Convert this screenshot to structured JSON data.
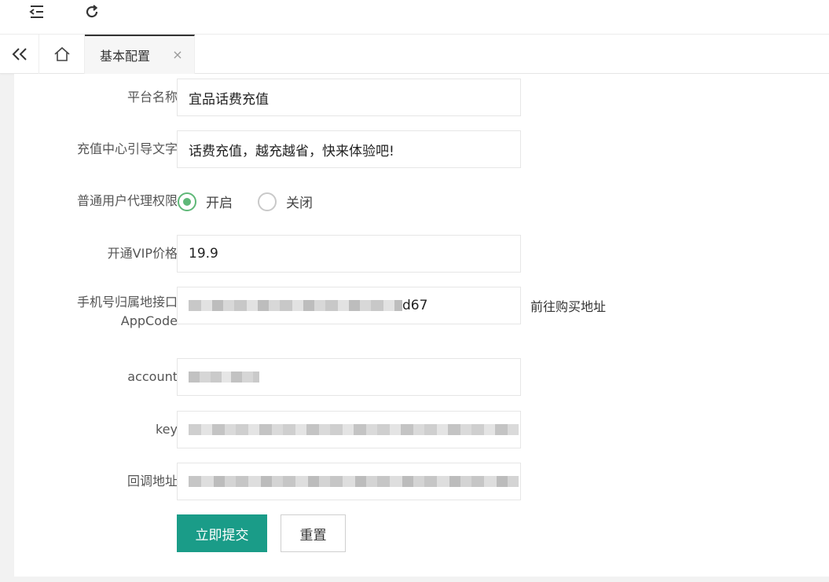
{
  "header": {
    "menu_icon": "indent-menu-icon",
    "refresh_icon": "refresh-icon"
  },
  "tabs": {
    "back_icon": "double-chevron-left-icon",
    "home_icon": "home-icon",
    "active_label": "基本配置",
    "close_glyph": "×"
  },
  "form": {
    "platform_name": {
      "label": "平台名称",
      "value": "宜品话费充值"
    },
    "guide_text": {
      "label": "充值中心引导文字",
      "value": "话费充值，越充越省，快来体验吧!"
    },
    "agent_permission": {
      "label": "普通用户代理权限",
      "options": [
        {
          "label": "开启",
          "checked": true
        },
        {
          "label": "关闭",
          "checked": false
        }
      ]
    },
    "vip_price": {
      "label": "开通VIP价格",
      "value": "19.9"
    },
    "appcode": {
      "label_line1": "手机号归属地接口",
      "label_line2": "AppCode",
      "value_suffix": "d67",
      "link": "前往购买地址"
    },
    "account": {
      "label": "account"
    },
    "key": {
      "label": "key"
    },
    "callback": {
      "label": "回调地址"
    },
    "submit_label": "立即提交",
    "reset_label": "重置"
  },
  "colors": {
    "primary": "#1a9c88",
    "radio_active": "#5fb878"
  }
}
